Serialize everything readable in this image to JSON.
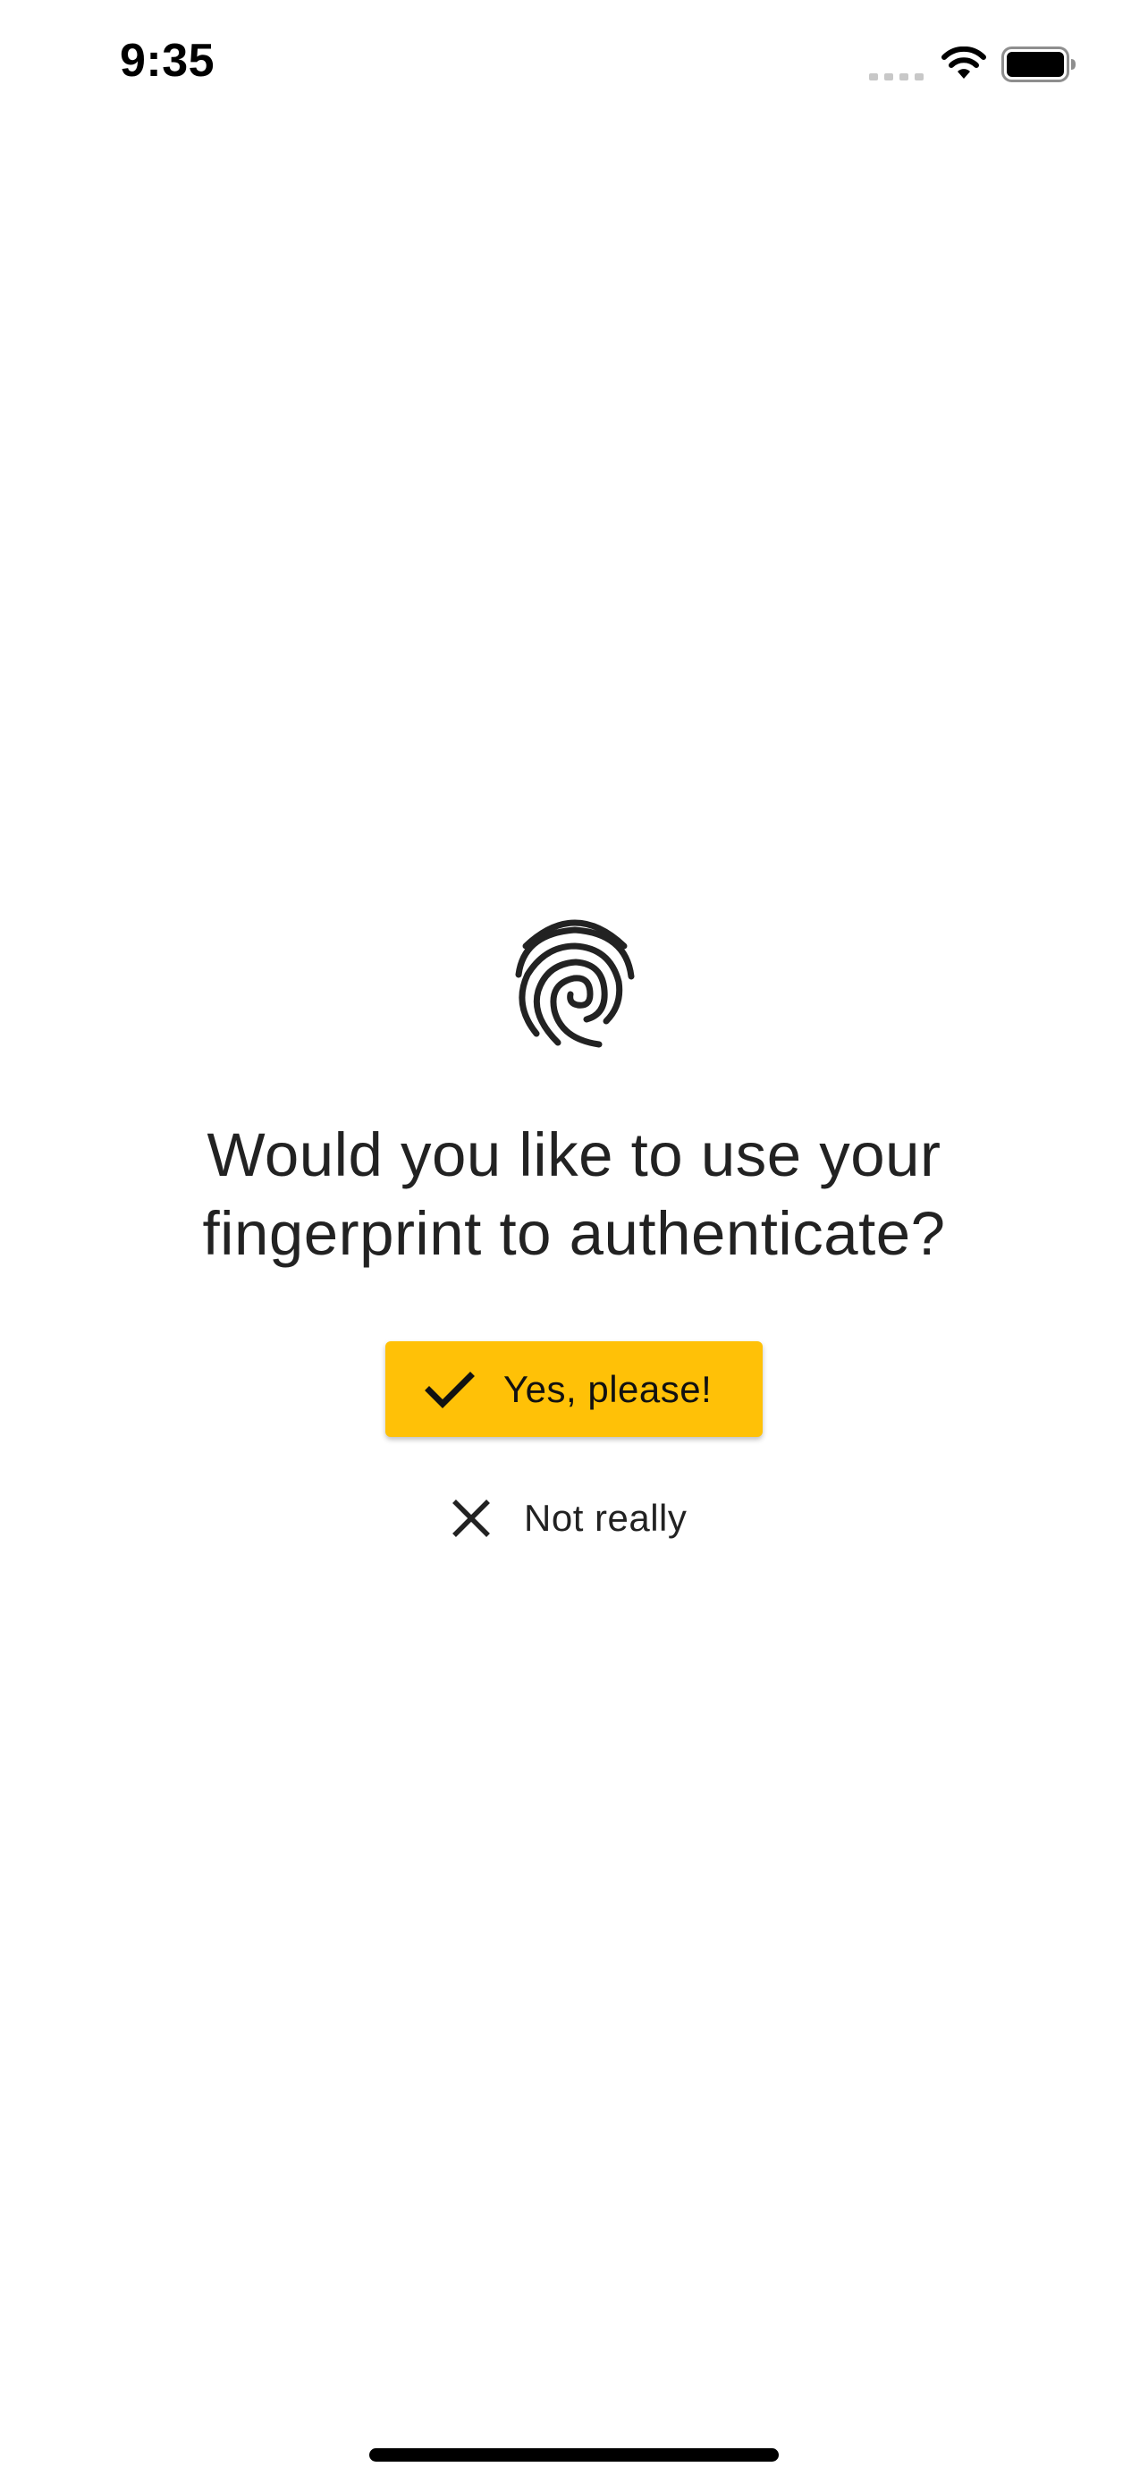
{
  "status_bar": {
    "time": "9:35",
    "icons": [
      "signal-dots-icon",
      "wifi-icon",
      "battery-icon"
    ]
  },
  "prompt": {
    "icon": "fingerprint-icon",
    "question": "Would you like to use your fingerprint to authenticate?"
  },
  "actions": {
    "yes_label": "Yes, please!",
    "yes_icon": "check-icon",
    "no_label": "Not really",
    "no_icon": "close-icon"
  },
  "colors": {
    "accent": "#FFC107",
    "text": "#222222",
    "background": "#FFFFFF"
  }
}
